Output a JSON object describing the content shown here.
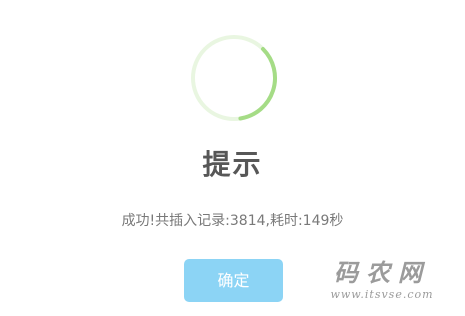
{
  "dialog": {
    "icon": "success-spinner-icon",
    "icon_progress": 0.35,
    "accent_color": "#A5DC86",
    "title": "提示",
    "message": "成功!共插入记录:3814,耗时:149秒",
    "confirm_label": "确定",
    "confirm_color": "#8CD4F5"
  },
  "watermark": {
    "logo_text": "码农网",
    "url_text": "www.itsvse.com"
  }
}
